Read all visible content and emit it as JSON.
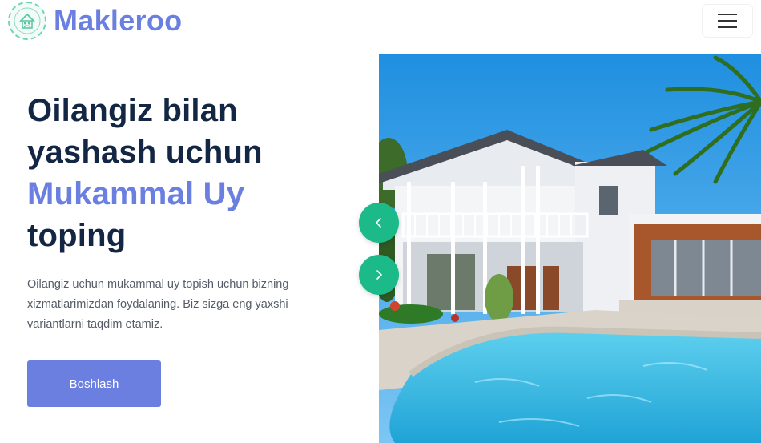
{
  "header": {
    "brand": "Makleroo",
    "logo_icon": "house-family-emblem-icon",
    "menu_icon": "hamburger-menu-icon"
  },
  "hero": {
    "title_line1": "Oilangiz bilan",
    "title_line2": "yashash uchun",
    "title_accent": "Mukammal Uy",
    "title_line4": "toping",
    "description": "Oilangiz uchun mukammal uy topish uchun bizning xizmatlarimizdan foydalaning. Biz sizga eng yaxshi variantlarni taqdim etamiz.",
    "cta_label": "Boshlash"
  },
  "carousel": {
    "prev_icon": "chevron-left-icon",
    "next_icon": "chevron-right-icon"
  },
  "colors": {
    "brand": "#6b7fe0",
    "heading": "#132745",
    "accent_green": "#1cb989"
  }
}
